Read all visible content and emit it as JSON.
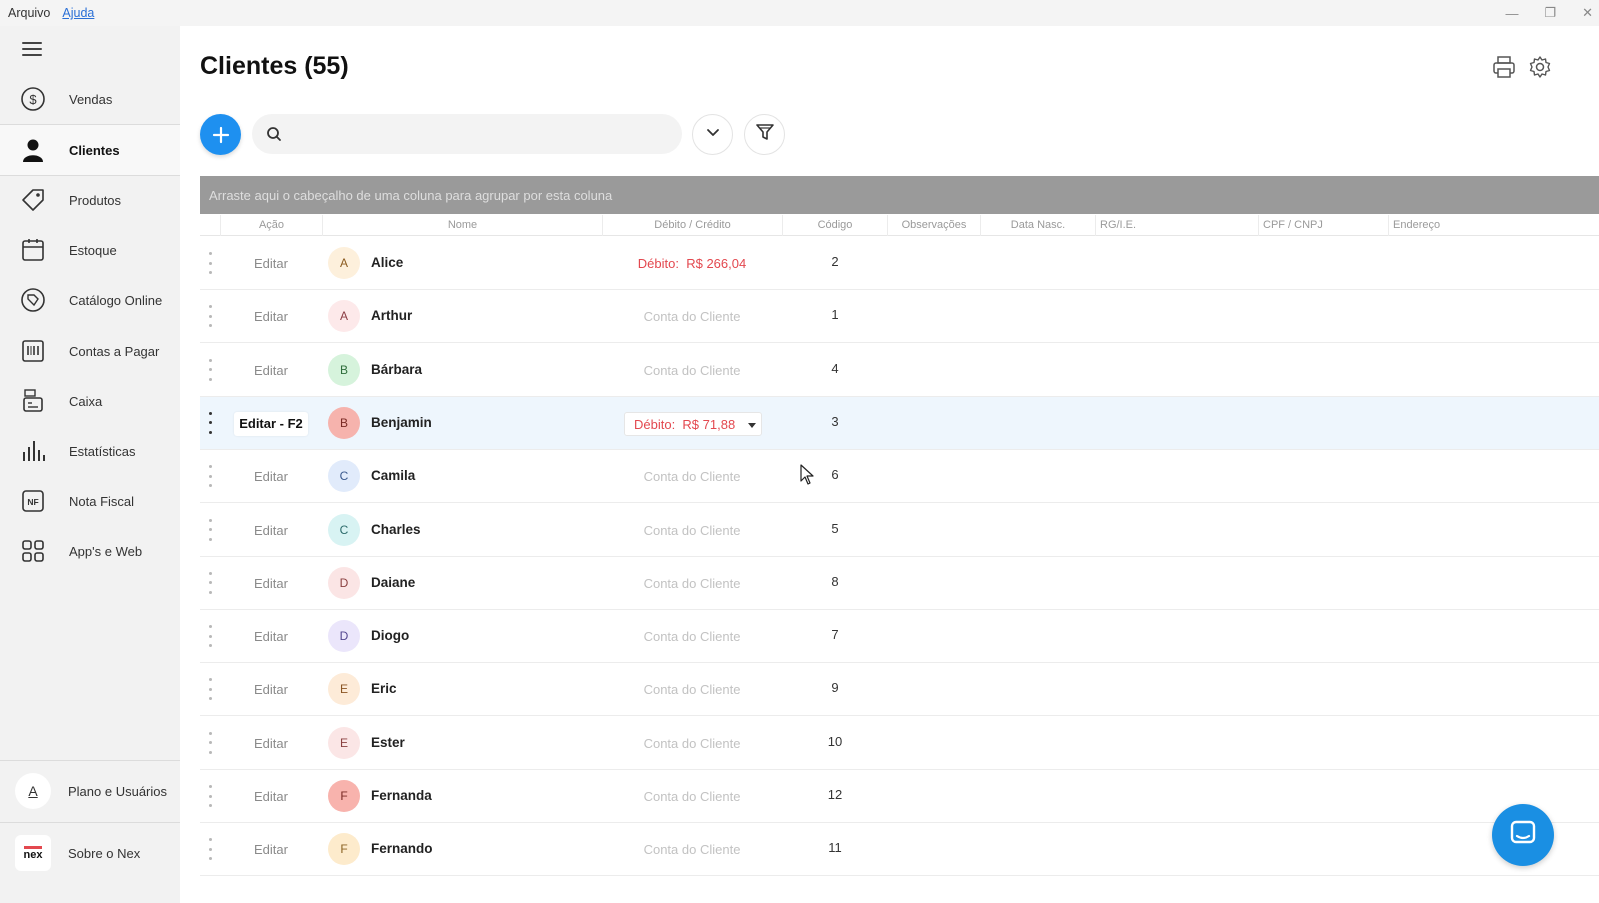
{
  "menubar": {
    "file": "Arquivo",
    "help": "Ajuda"
  },
  "window_controls": {
    "minimize": "—",
    "restore": "❐",
    "close": "✕"
  },
  "sidebar": {
    "items": [
      {
        "label": "Vendas",
        "icon": "dollar-circle-icon"
      },
      {
        "label": "Clientes",
        "icon": "person-icon",
        "active": true
      },
      {
        "label": "Produtos",
        "icon": "tag-icon"
      },
      {
        "label": "Estoque",
        "icon": "box-icon"
      },
      {
        "label": "Catálogo Online",
        "icon": "catalog-icon"
      },
      {
        "label": "Contas a Pagar",
        "icon": "barcode-icon"
      },
      {
        "label": "Caixa",
        "icon": "cash-register-icon"
      },
      {
        "label": "Estatísticas",
        "icon": "bar-chart-icon"
      },
      {
        "label": "Nota Fiscal",
        "icon": "nf-icon"
      },
      {
        "label": "App's e Web",
        "icon": "apps-grid-icon"
      }
    ],
    "footer": [
      {
        "label": "Plano e Usuários",
        "avatar_letter": "A"
      },
      {
        "label": "Sobre o Nex",
        "logo_text": "nex"
      }
    ]
  },
  "page": {
    "title": "Clientes (55)"
  },
  "search": {
    "placeholder": "",
    "value": ""
  },
  "group_bar": {
    "text": "Arraste aqui o cabeçalho de uma coluna para agrupar por esta coluna"
  },
  "columns": [
    "Ação",
    "Nome",
    "Débito / Crédito",
    "Código",
    "Observações",
    "Data Nasc.",
    "RG/I.E.",
    "CPF / CNPJ",
    "Endereço"
  ],
  "rows": [
    {
      "action": "Editar",
      "initial": "A",
      "name": "Alice",
      "balance": "Débito:  R$ 266,04",
      "balance_type": "debit",
      "code": "2",
      "avatar_bg": "#fdf0dc",
      "avatar_fg": "#8a5a1e"
    },
    {
      "action": "Editar",
      "initial": "A",
      "name": "Arthur",
      "balance": "Conta do Cliente",
      "balance_type": "none",
      "code": "1",
      "avatar_bg": "#fde9ea",
      "avatar_fg": "#8b3c43"
    },
    {
      "action": "Editar",
      "initial": "B",
      "name": "Bárbara",
      "balance": "Conta do Cliente",
      "balance_type": "none",
      "code": "4",
      "avatar_bg": "#d6f3dc",
      "avatar_fg": "#2f6e3c"
    },
    {
      "action": "Editar - F2",
      "initial": "B",
      "name": "Benjamin",
      "balance": "Débito:  R$ 71,88",
      "balance_type": "debit-dropdown",
      "code": "3",
      "avatar_bg": "#f6b3ad",
      "avatar_fg": "#7a2a24",
      "selected": true
    },
    {
      "action": "Editar",
      "initial": "C",
      "name": "Camila",
      "balance": "Conta do Cliente",
      "balance_type": "none",
      "code": "6",
      "avatar_bg": "#e1ebfb",
      "avatar_fg": "#3b5a8e"
    },
    {
      "action": "Editar",
      "initial": "C",
      "name": "Charles",
      "balance": "Conta do Cliente",
      "balance_type": "none",
      "code": "5",
      "avatar_bg": "#d8f3f3",
      "avatar_fg": "#2c6b6b"
    },
    {
      "action": "Editar",
      "initial": "D",
      "name": "Daiane",
      "balance": "Conta do Cliente",
      "balance_type": "none",
      "code": "8",
      "avatar_bg": "#fbe5e5",
      "avatar_fg": "#8a3f3f"
    },
    {
      "action": "Editar",
      "initial": "D",
      "name": "Diogo",
      "balance": "Conta do Cliente",
      "balance_type": "none",
      "code": "7",
      "avatar_bg": "#ebe6fb",
      "avatar_fg": "#52458e"
    },
    {
      "action": "Editar",
      "initial": "E",
      "name": "Eric",
      "balance": "Conta do Cliente",
      "balance_type": "none",
      "code": "9",
      "avatar_bg": "#fdebd8",
      "avatar_fg": "#8a5523"
    },
    {
      "action": "Editar",
      "initial": "E",
      "name": "Ester",
      "balance": "Conta do Cliente",
      "balance_type": "none",
      "code": "10",
      "avatar_bg": "#fbe6e6",
      "avatar_fg": "#8a4040"
    },
    {
      "action": "Editar",
      "initial": "F",
      "name": "Fernanda",
      "balance": "Conta do Cliente",
      "balance_type": "none",
      "code": "12",
      "avatar_bg": "#f8b3ad",
      "avatar_fg": "#7a2a24"
    },
    {
      "action": "Editar",
      "initial": "F",
      "name": "Fernando",
      "balance": "Conta do Cliente",
      "balance_type": "none",
      "code": "11",
      "avatar_bg": "#fdebcc",
      "avatar_fg": "#8a6223"
    }
  ],
  "colors": {
    "accent": "#1e90f0",
    "debit": "#e3484f",
    "selected_row": "#eef6fd",
    "group_bar": "#9a9a9a"
  }
}
